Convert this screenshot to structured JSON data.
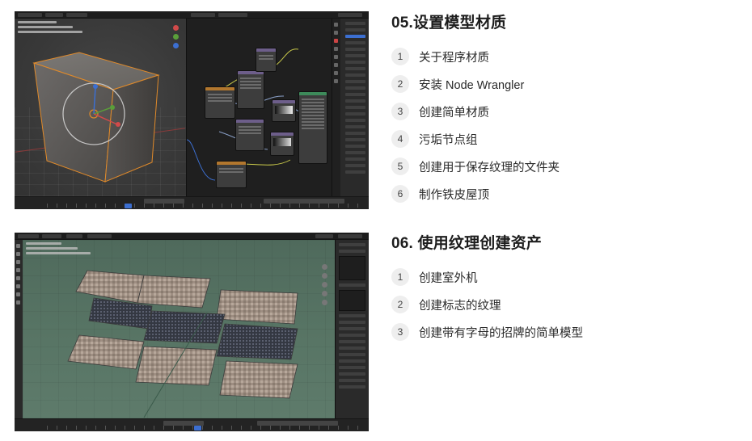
{
  "screenshot1": {
    "description_icon": "blender-node-editor-screenshot"
  },
  "screenshot2": {
    "description_icon": "blender-viewport-screenshot"
  },
  "sections": [
    {
      "title": "05.设置模型材质",
      "items": [
        {
          "num": "1",
          "label": "关于程序材质"
        },
        {
          "num": "2",
          "label": "安装 Node Wrangler"
        },
        {
          "num": "3",
          "label": "创建简单材质"
        },
        {
          "num": "4",
          "label": "污垢节点组"
        },
        {
          "num": "5",
          "label": "创建用于保存纹理的文件夹"
        },
        {
          "num": "6",
          "label": "制作铁皮屋顶"
        }
      ]
    },
    {
      "title": "06. 使用纹理创建资产",
      "items": [
        {
          "num": "1",
          "label": "创建室外机"
        },
        {
          "num": "2",
          "label": "创建标志的纹理"
        },
        {
          "num": "3",
          "label": "创建带有字母的招牌的简单模型"
        }
      ]
    }
  ],
  "colors": {
    "accent_blue": "#3c6fd1",
    "selection_orange": "#e08a2a",
    "badge_bg": "#eeeeee"
  }
}
